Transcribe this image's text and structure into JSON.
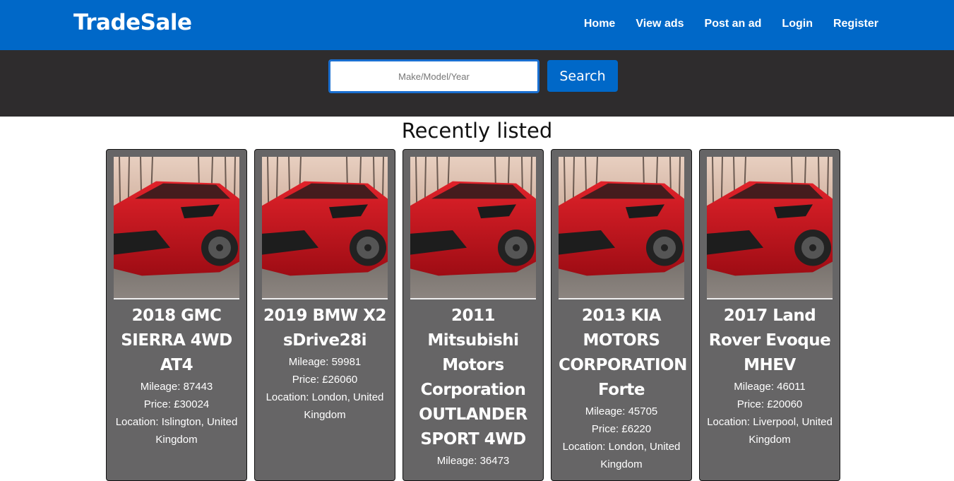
{
  "header": {
    "logo": "TradeSale",
    "nav": [
      "Home",
      "View ads",
      "Post an ad",
      "Login",
      "Register"
    ]
  },
  "search": {
    "placeholder": "Make/Model/Year",
    "button_label": "Search"
  },
  "listings": {
    "title": "Recently listed",
    "cards": [
      {
        "title": "2018 GMC SIERRA 4WD AT4",
        "mileage": "Mileage: 87443",
        "price": "Price: £30024",
        "location": "Location: Islington, United Kingdom"
      },
      {
        "title": "2019 BMW X2 sDrive28i",
        "mileage": "Mileage: 59981",
        "price": "Price: £26060",
        "location": "Location: London, United Kingdom"
      },
      {
        "title": "2011 Mitsubishi Motors Corporation OUTLANDER SPORT 4WD",
        "mileage": "Mileage: 36473",
        "price": "",
        "location": ""
      },
      {
        "title": "2013 KIA MOTORS CORPORATION Forte",
        "mileage": "Mileage: 45705",
        "price": "Price: £6220",
        "location": "Location: London, United Kingdom"
      },
      {
        "title": "2017 Land Rover Evoque MHEV",
        "mileage": "Mileage: 46011",
        "price": "Price: £20060",
        "location": "Location: Liverpool, United Kingdom"
      }
    ]
  },
  "colors": {
    "navbar": "#0068c8",
    "search_bar": "#2e2c2d",
    "card": "#666566"
  },
  "icons": {
    "card_image": "red-car-photo"
  }
}
